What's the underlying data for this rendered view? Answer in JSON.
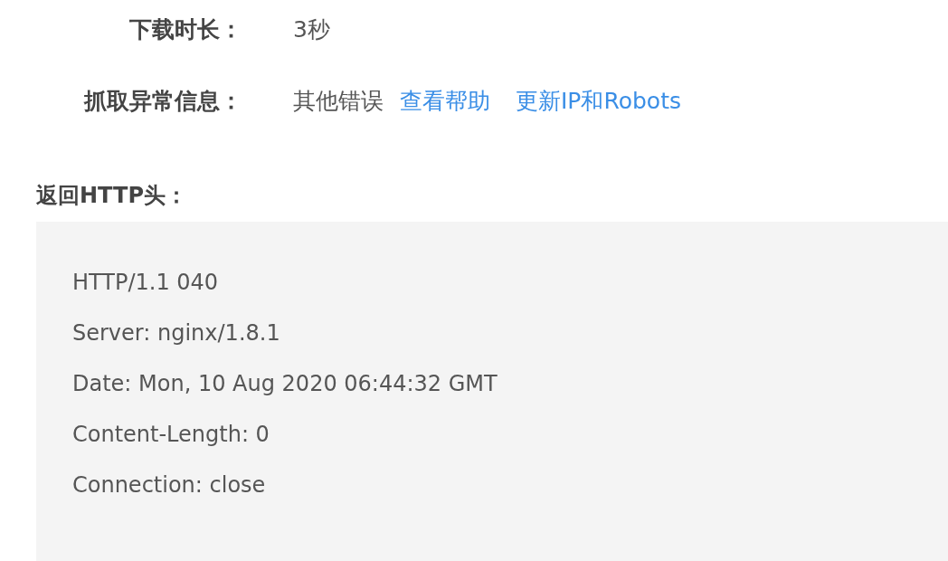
{
  "fields": [
    {
      "label": "下载时长：",
      "parts": [
        {
          "kind": "text",
          "text": "3秒"
        }
      ]
    },
    {
      "label": "抓取异常信息：",
      "parts": [
        {
          "kind": "text",
          "text": "其他错误"
        },
        {
          "kind": "link",
          "text": "查看帮助"
        },
        {
          "kind": "link",
          "text": "更新IP和Robots"
        }
      ]
    }
  ],
  "http_headers": {
    "title": "返回HTTP头：",
    "lines": [
      "HTTP/1.1 040",
      "Server: nginx/1.8.1",
      "Date: Mon, 10 Aug 2020 06:44:32 GMT",
      "Content-Length: 0",
      "Connection: close"
    ]
  }
}
